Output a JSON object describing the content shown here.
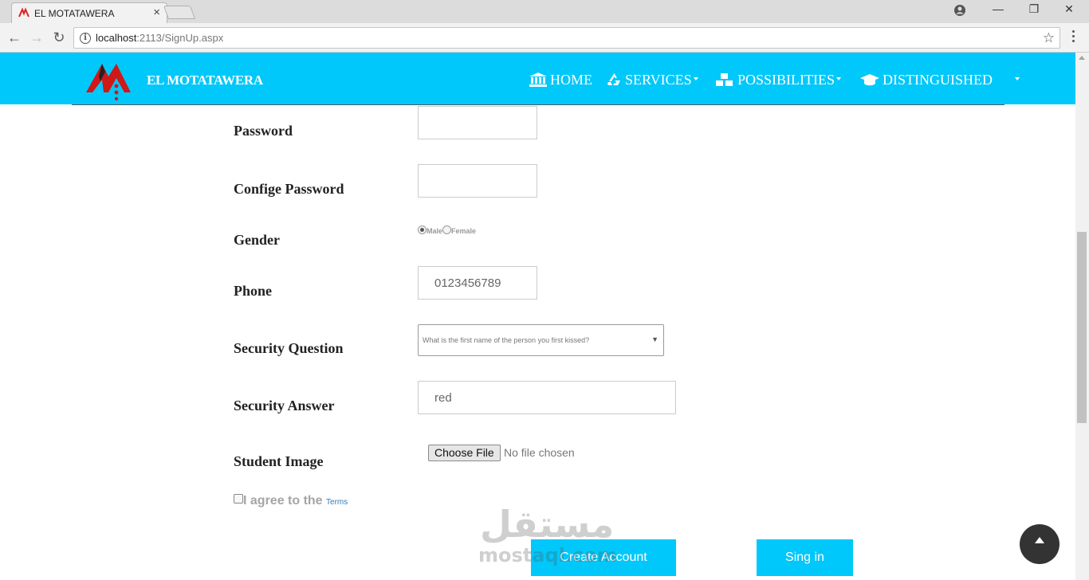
{
  "browser": {
    "tab_title": "EL MOTATAWERA",
    "url_host": "localhost",
    "url_rest": ":2113/SignUp.aspx",
    "win_minimize": "—",
    "win_restore": "❐",
    "win_close": "✕"
  },
  "site": {
    "brand": "EL MOTATAWERA",
    "nav": {
      "home": "HOME",
      "services": "SERVICES",
      "possibilities": "POSSIBILITIES",
      "distinguished": "DISTINGUISHED"
    },
    "colors": {
      "primary": "#00c8fa",
      "logo_red": "#e02020"
    }
  },
  "form": {
    "password_label": "Password",
    "confirm_label": "Confige Password",
    "gender_label": "Gender",
    "gender_male": "Male",
    "gender_female": "Female",
    "gender_selected": "Male",
    "phone_label": "Phone",
    "phone_value": "0123456789",
    "question_label": "Security Question",
    "question_value": "What is the first name of the person you first kissed?",
    "answer_label": "Security Answer",
    "answer_value": "red",
    "image_label": "Student Image",
    "file_button": "Choose File",
    "file_status": "No file chosen",
    "agree_text": "I agree to the",
    "terms_link": "Terms",
    "create_button": "Create Account",
    "signin_button": "Sing in"
  },
  "watermark": {
    "arabic": "مستقل",
    "latin": "mostaql.com"
  },
  "icons": [
    "info-icon",
    "star-icon",
    "bank-icon",
    "recycle-icon",
    "cubes-icon",
    "graduation-cap-icon",
    "arrow-up-icon"
  ]
}
